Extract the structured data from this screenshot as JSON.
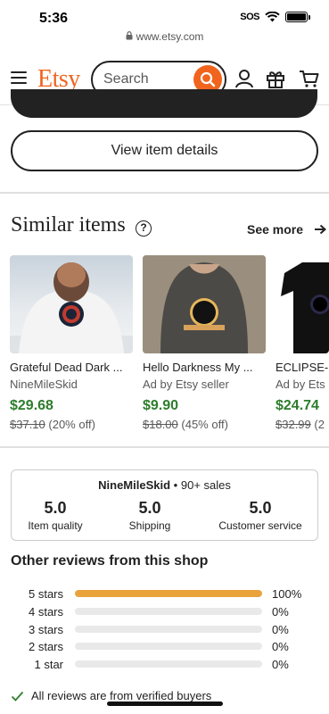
{
  "status": {
    "time": "5:36",
    "sos": "SOS"
  },
  "browser": {
    "url": "www.etsy.com"
  },
  "header": {
    "logo": "Etsy",
    "search_placeholder": "Search"
  },
  "main": {
    "view_details_label": "View item details"
  },
  "similar": {
    "title": "Similar items",
    "see_more": "See more",
    "items": [
      {
        "title": "Grateful Dead Dark ...",
        "shop": "NineMileSkid",
        "price": "$29.68",
        "orig": "$37.10",
        "discount": "(20% off)"
      },
      {
        "title": "Hello Darkness My ...",
        "shop": "Ad by Etsy seller",
        "price": "$9.90",
        "orig": "$18.00",
        "discount": "(45% off)"
      },
      {
        "title": "ECLIPSE-",
        "shop": "Ad by Ets",
        "price": "$24.74",
        "orig": "$32.99",
        "discount": "(2"
      }
    ]
  },
  "shop": {
    "name": "NineMileSkid",
    "separator": "•",
    "sales": "90+ sales",
    "stats": [
      {
        "value": "5.0",
        "label": "Item quality"
      },
      {
        "value": "5.0",
        "label": "Shipping"
      },
      {
        "value": "5.0",
        "label": "Customer service"
      }
    ]
  },
  "reviews": {
    "title": "Other reviews from this shop",
    "rows": [
      {
        "label": "5 stars",
        "pct": "100%",
        "fill": 1.0
      },
      {
        "label": "4 stars",
        "pct": "0%",
        "fill": 0
      },
      {
        "label": "3 stars",
        "pct": "0%",
        "fill": 0
      },
      {
        "label": "2 stars",
        "pct": "0%",
        "fill": 0
      },
      {
        "label": "1 star",
        "pct": "0%",
        "fill": 0
      }
    ],
    "verified_note": "All reviews are from verified buyers"
  },
  "colors": {
    "brand": "#f1641e",
    "price": "#2d7d2b",
    "rating": "#e8a33b"
  }
}
